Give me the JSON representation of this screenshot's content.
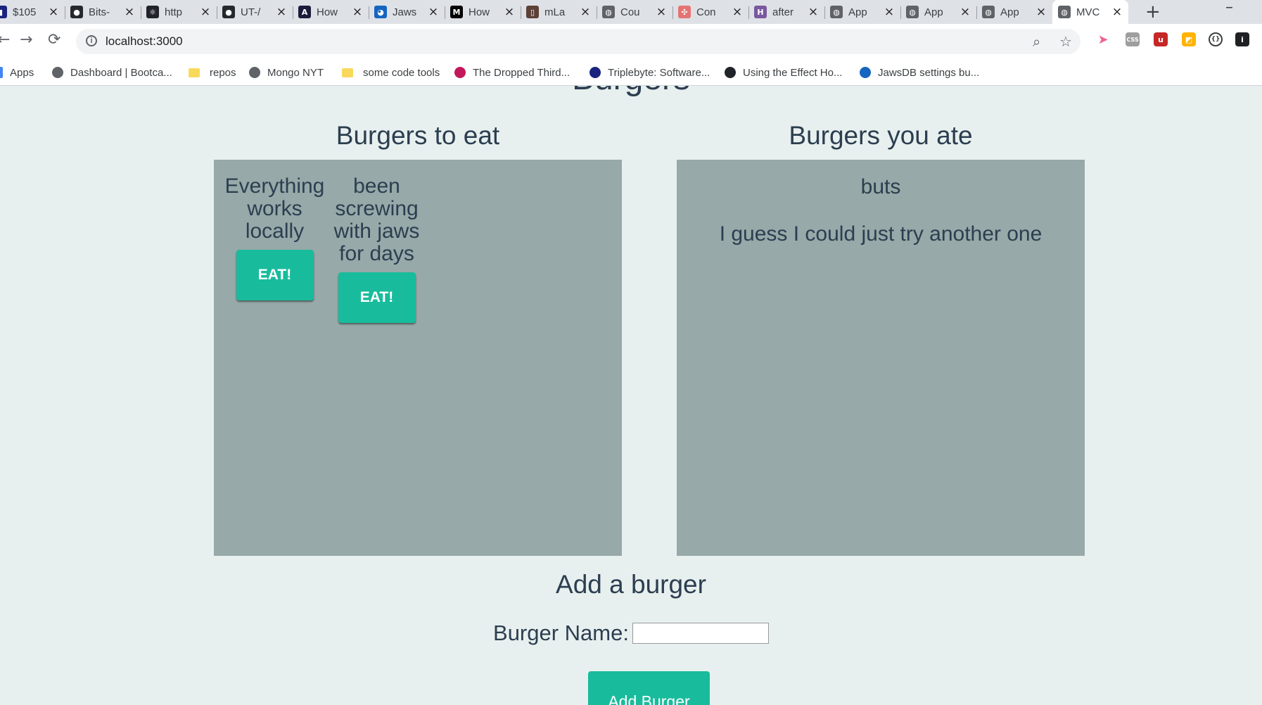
{
  "browser": {
    "tabs": [
      {
        "title": "$105",
        "favicon": "chart-bars-icon",
        "color": "#1a237e"
      },
      {
        "title": "Bits-",
        "favicon": "github-icon",
        "color": "#24292e"
      },
      {
        "title": "http",
        "favicon": "react-icon",
        "color": "#20232a"
      },
      {
        "title": "UT-/",
        "favicon": "github-icon",
        "color": "#24292e"
      },
      {
        "title": "How",
        "favicon": "logo-icon",
        "color": "#1b1b3a"
      },
      {
        "title": "Jaws",
        "favicon": "jawsdb-icon",
        "color": "#1565c0"
      },
      {
        "title": "How",
        "favicon": "medium-icon",
        "color": "#000000"
      },
      {
        "title": "mLa",
        "favicon": "mlab-icon",
        "color": "#5d4037"
      },
      {
        "title": "Cou",
        "favicon": "globe-icon",
        "color": "#5f6368"
      },
      {
        "title": "Con",
        "favicon": "bird-icon",
        "color": "#e57373"
      },
      {
        "title": "after",
        "favicon": "heroku-icon",
        "color": "#79589f"
      },
      {
        "title": "App",
        "favicon": "globe-icon",
        "color": "#5f6368"
      },
      {
        "title": "App",
        "favicon": "globe-icon",
        "color": "#5f6368"
      },
      {
        "title": "App",
        "favicon": "globe-icon",
        "color": "#5f6368"
      },
      {
        "title": "MVC",
        "favicon": "globe-icon",
        "color": "#5f6368",
        "active": true
      }
    ],
    "new_tab": "+",
    "minimize": "–",
    "url": "localhost:3000",
    "bookmarks": [
      {
        "label": "Apps",
        "icon": "apps-grid-icon"
      },
      {
        "label": "Dashboard | Bootca...",
        "icon": "globe-icon"
      },
      {
        "label": "repos",
        "icon": "folder-icon"
      },
      {
        "label": "Mongo NYT",
        "icon": "globe-icon"
      },
      {
        "label": "some code tools",
        "icon": "folder-icon"
      },
      {
        "label": "The Dropped Third...",
        "icon": "bird-icon"
      },
      {
        "label": "Triplebyte: Software...",
        "icon": "hexagon-icon"
      },
      {
        "label": "Using the Effect Ho...",
        "icon": "react-icon"
      },
      {
        "label": "JawsDB settings bu...",
        "icon": "jawsdb-icon"
      }
    ]
  },
  "page": {
    "title": "Burgers",
    "to_eat_heading": "Burgers to eat",
    "ate_heading": "Burgers you ate",
    "to_eat": [
      {
        "name": "Everything works locally",
        "button": "EAT!"
      },
      {
        "name": "been screwing with jaws for days",
        "button": "EAT!"
      }
    ],
    "eaten": [
      "buts",
      "I guess I could just try another one"
    ],
    "add_heading": "Add a burger",
    "name_label": "Burger Name:",
    "input_value": "",
    "add_button": "Add Burger"
  },
  "colors": {
    "background": "#e8f0ef",
    "panel": "#97a9a8",
    "text": "#2c3e50",
    "accent": "#18bc9c"
  }
}
